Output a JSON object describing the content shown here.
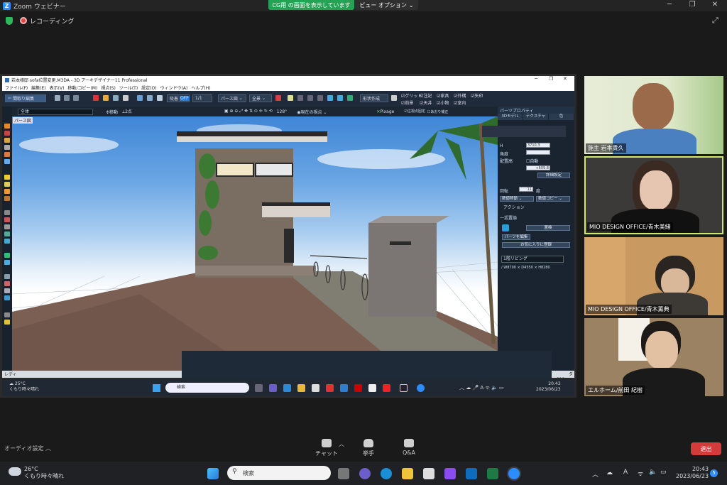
{
  "zoom": {
    "window_title": "Zoom ウェビナー",
    "share_banner": "CG用 の画面を表示しています",
    "view_options": "ビュー オプション",
    "recording_label": "レコーディング",
    "controls": {
      "audio_settings": "オーディオ設定",
      "chat": "チャット",
      "raise_hand": "挙手",
      "qa": "Q&A",
      "leave": "退出"
    },
    "participants": [
      {
        "name": "施主 岩本貴久",
        "bg": "#cfe0b8"
      },
      {
        "name": "MIO DESIGN OFFICE/青木美緒",
        "bg": "#3b3a38",
        "active_speaker": true
      },
      {
        "name": "MIO DESIGN OFFICE/青木薫典",
        "bg": "#c89a62"
      },
      {
        "name": "エルホーム/前田 紀樹",
        "bg": "#9b8262"
      }
    ]
  },
  "shared_app": {
    "title": "岩本様邸 sofa位置変更.M3DA - 3D アーキデザイナー11 Professional",
    "menus": [
      "ファイル(F)",
      "編集(E)",
      "表示(V)",
      "移動/コピー(M)",
      "視点(S)",
      "ツール(T)",
      "設定(O)",
      "ウィンドウ(A)",
      "ヘルプ(H)"
    ],
    "toolbar": {
      "back_button": "間取り編集",
      "snap_label": "吸着",
      "snap_state": "OFF",
      "page": "1/1",
      "perspective": "パース図",
      "theme": "全景",
      "shape_create": "形状作成",
      "checkboxes": [
        "グリッド",
        "注記",
        "家具",
        "外構",
        "矢印",
        "前景",
        "天井",
        "小物",
        "室内"
      ]
    },
    "toolbar2": {
      "scope": "全体",
      "move_label": "移動",
      "two_point": "2点",
      "angle": "128°",
      "current_view": "現在の視点",
      "pixage": "Pixage",
      "render_options": [
        "注視点固定",
        "テクスチャ",
        "あおり補正"
      ]
    },
    "view_tab": "パース図",
    "status_left": "レディ",
    "status_right": "ダ 910mm",
    "panel": {
      "title": "パーツプロパティ",
      "tabs": [
        "3Dモデル",
        "テクスチャ",
        "色"
      ],
      "height_label": "H",
      "height_value": "3710.3",
      "angle_label": "角度",
      "placement_label": "配置高",
      "auto_label": "自動",
      "placement_value": "+609.8",
      "detail_button": "詳細設定",
      "rotation_label": "回転",
      "rotation_value": "11",
      "rotation_unit": "度",
      "move_select": "数値移動",
      "copy_select": "数値コピー",
      "action_label": "アクション",
      "bulk_replace": "一括置換",
      "replace_button": "置換",
      "parts_edit": "パーツを編集",
      "favorite_button": "お気に入りに登録",
      "room_item": "1階リビング",
      "dimensions": "/ W8700 × D4550 × H8280"
    },
    "taskbar": {
      "weather_temp": "25°C",
      "weather_desc": "くもり時々晴れ",
      "search": "検索",
      "time": "20:43",
      "date": "2023/06/23"
    }
  },
  "taskbar": {
    "weather_temp": "26°C",
    "weather_desc": "くもり時々晴れ",
    "search": "検索",
    "time": "20:43",
    "date": "2023/06/23",
    "notification_count": "5"
  }
}
